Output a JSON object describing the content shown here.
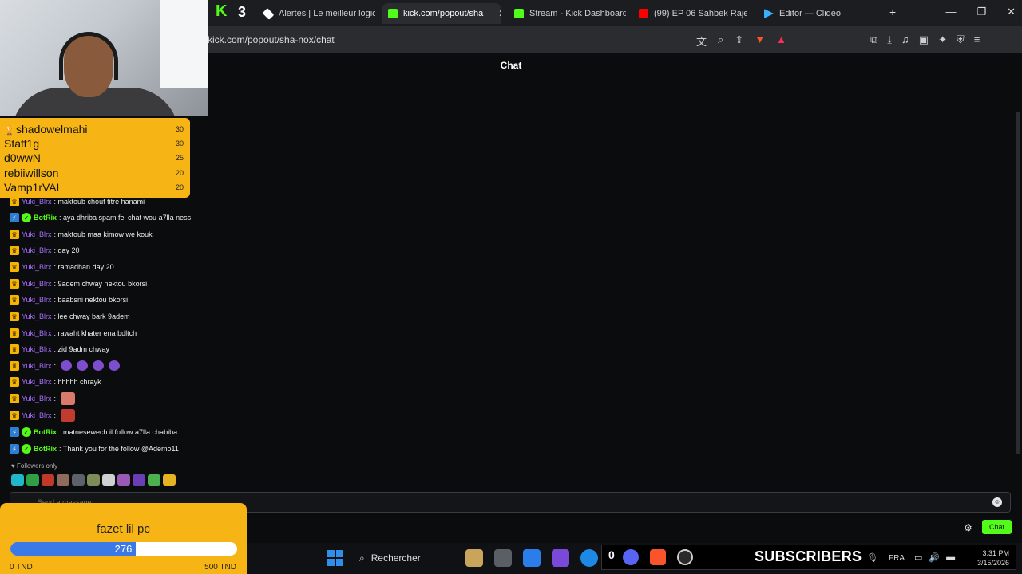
{
  "browser": {
    "tabs": [
      {
        "label": "Alertes | Le meilleur logici",
        "color": "#ffffff"
      },
      {
        "label": "kick.com/popout/sha",
        "color": "#53fc18",
        "active": true
      },
      {
        "label": "Stream - Kick Dashboard",
        "color": "#53fc18"
      },
      {
        "label": "(99) EP 06 Sahbek Rajel 2",
        "color": "#ff0000"
      },
      {
        "label": "Editor — Clideo",
        "color": "#3bb0ff"
      }
    ],
    "pinned_logo": "K",
    "pinned_count": "3",
    "address": "kick.com/popout/sha-nox/chat",
    "new_tab_label": "+"
  },
  "chat": {
    "title": "Chat",
    "followers_only": "Followers only",
    "input_placeholder": "Send a message",
    "send_label": "Chat",
    "messages": [
      {
        "user": "Yuki_Blrx",
        "type": "yuki",
        "text": ": maktoub chouf titre hanami"
      },
      {
        "user": "BotRix",
        "type": "bot",
        "text": ": aya dhriba spam fel chat wou a7lla ness"
      },
      {
        "user": "Yuki_Blrx",
        "type": "yuki",
        "text": ": maktoub maa kimow we kouki"
      },
      {
        "user": "Yuki_Blrx",
        "type": "yuki",
        "text": ": day 20"
      },
      {
        "user": "Yuki_Blrx",
        "type": "yuki",
        "text": ": ramadhan day 20"
      },
      {
        "user": "Yuki_Blrx",
        "type": "yuki",
        "text": ": 9adem chway nektou bkorsi"
      },
      {
        "user": "Yuki_Blrx",
        "type": "yuki",
        "text": ": baabsni nektou bkorsi"
      },
      {
        "user": "Yuki_Blrx",
        "type": "yuki",
        "text": ": lee chway bark 9adem"
      },
      {
        "user": "Yuki_Blrx",
        "type": "yuki",
        "text": ": rawaht khater ena bdltch"
      },
      {
        "user": "Yuki_Blrx",
        "type": "yuki",
        "text": ": zid 9adm chway"
      },
      {
        "user": "Yuki_Blrx",
        "type": "yuki",
        "text": ":",
        "emotes": 4
      },
      {
        "user": "Yuki_Blrx",
        "type": "yuki",
        "text": ": hhhhh chrayk"
      },
      {
        "user": "Yuki_Blrx",
        "type": "yuki",
        "text": ":",
        "face": "normal"
      },
      {
        "user": "Yuki_Blrx",
        "type": "yuki",
        "text": ":",
        "face": "red"
      },
      {
        "user": "BotRix",
        "type": "bot",
        "text": ": matnesewech il follow a7lla chabiba"
      },
      {
        "user": "BotRix",
        "type": "bot",
        "text": ": Thank you for the follow @Ademo11"
      }
    ]
  },
  "leaderboard": [
    {
      "name": "shadowelmahi",
      "score": "30",
      "trophy": true
    },
    {
      "name": "Staff1g",
      "score": "30"
    },
    {
      "name": "d0wwN",
      "score": "25"
    },
    {
      "name": "rebiiwillson",
      "score": "20"
    },
    {
      "name": "Vamp1rVAL",
      "score": "20"
    }
  ],
  "goal": {
    "title": "fazet lil pc",
    "current": "276",
    "progress_fraction": 0.552,
    "min_label": "0 TND",
    "max_label": "500 TND"
  },
  "taskbar": {
    "search_label": "Rechercher",
    "subs_count": "0",
    "subs_label": "SUBSCRIBERS",
    "lang": "FRA",
    "time": "3:31 PM",
    "date": "3/15/2026"
  },
  "colors": {
    "kick_green": "#53fc18",
    "overlay_yellow": "#f7b515",
    "goal_blue": "#3b79e6"
  }
}
